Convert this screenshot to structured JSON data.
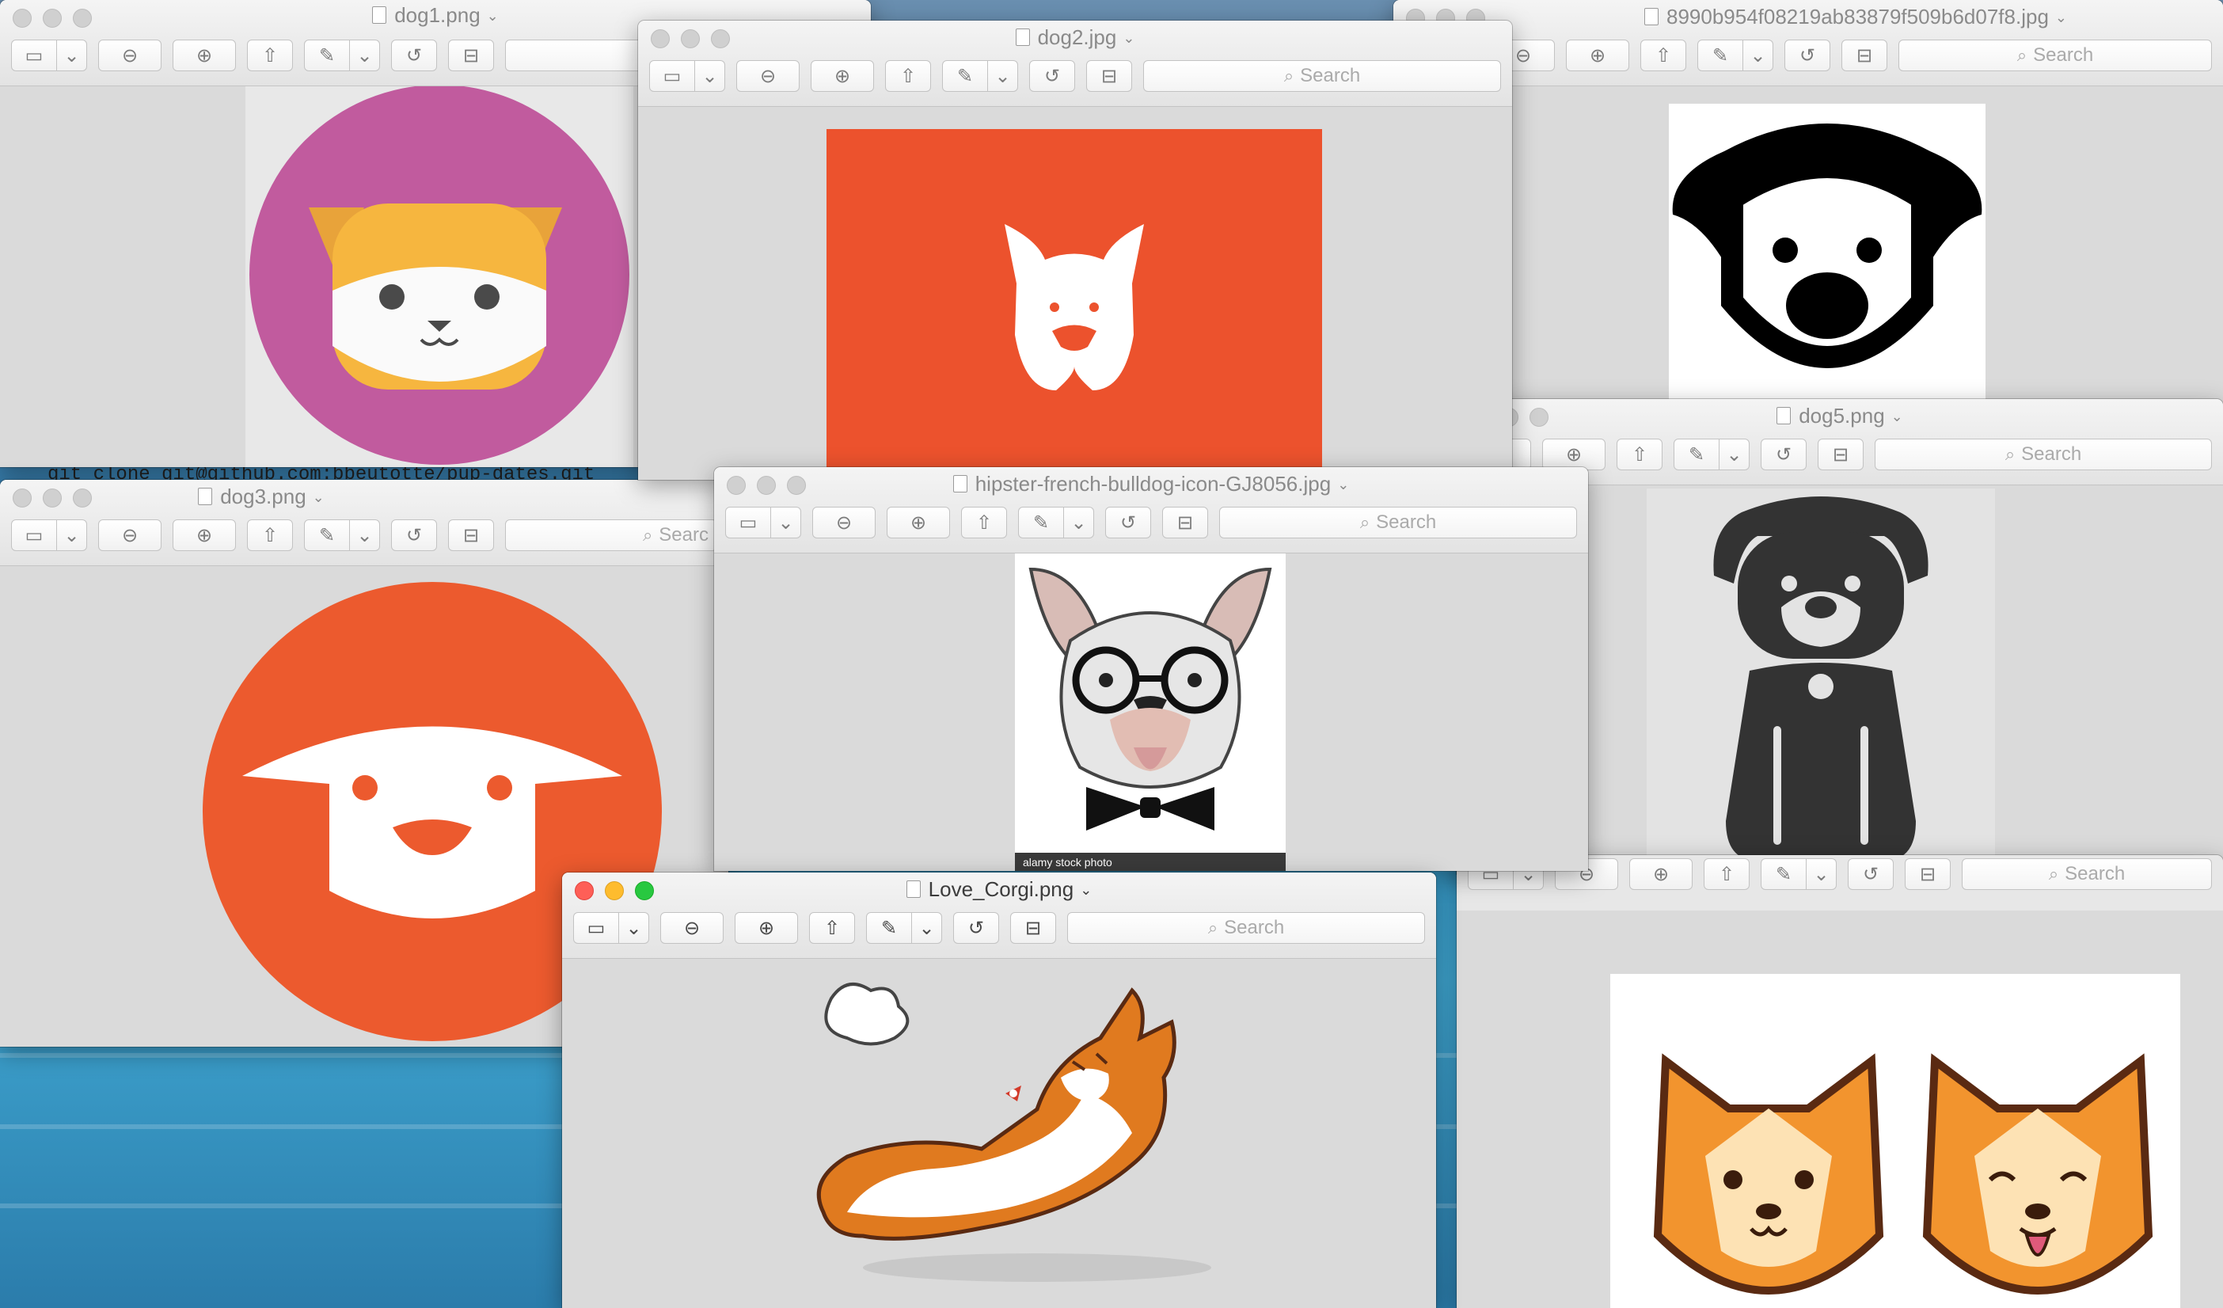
{
  "windows": {
    "dog1": {
      "title": "dog1.png"
    },
    "dog2": {
      "title": "dog2.jpg",
      "search": "Search"
    },
    "hash": {
      "title": "8990b954f08219ab83879f509b6d07f8.jpg",
      "search": "Search"
    },
    "dog5": {
      "title": "dog5.png",
      "search": "Search"
    },
    "dog3": {
      "title": "dog3.png",
      "search": "Searc"
    },
    "hipster": {
      "title": "hipster-french-bulldog-icon-GJ8056.jpg",
      "search": "Search",
      "caption": "alamy stock photo"
    },
    "corgi_right": {
      "search": "Search"
    },
    "love_corgi": {
      "title": "Love_Corgi.png",
      "search": "Search"
    }
  },
  "terminal": {
    "line": "git clone git@github.com:bbeutotte/pup-dates.git"
  },
  "icons": [
    "sidebar-icon",
    "zoom-out-icon",
    "zoom-in-icon",
    "share-icon",
    "markup-pen-icon",
    "rotate-icon",
    "toolbox-icon",
    "search-icon"
  ],
  "colors": {
    "dog1_bg": "#c15b9e",
    "dog2_bg": "#ec522d",
    "dog3_bg": "#ec5a2e",
    "dog5_fill": "#333333",
    "corgi_orange": "#f2942e"
  }
}
